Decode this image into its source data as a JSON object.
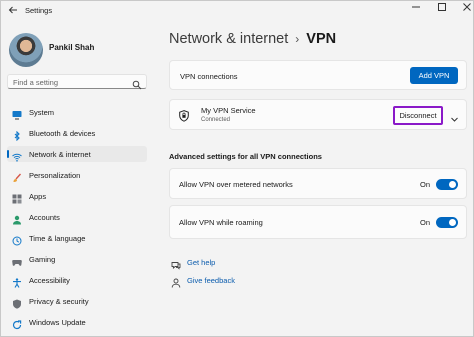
{
  "window": {
    "app_title": "Settings"
  },
  "sidebar": {
    "user_name": "Pankil Shah",
    "search_placeholder": "Find a setting",
    "items": [
      {
        "label": "System",
        "icon": "monitor-icon"
      },
      {
        "label": "Bluetooth & devices",
        "icon": "bluetooth-icon"
      },
      {
        "label": "Network & internet",
        "icon": "wifi-icon",
        "selected": true
      },
      {
        "label": "Personalization",
        "icon": "brush-icon"
      },
      {
        "label": "Apps",
        "icon": "apps-grid-icon"
      },
      {
        "label": "Accounts",
        "icon": "person-icon"
      },
      {
        "label": "Time & language",
        "icon": "clock-globe-icon"
      },
      {
        "label": "Gaming",
        "icon": "gamepad-icon"
      },
      {
        "label": "Accessibility",
        "icon": "accessibility-icon"
      },
      {
        "label": "Privacy & security",
        "icon": "shield-icon"
      },
      {
        "label": "Windows Update",
        "icon": "refresh-icon"
      }
    ]
  },
  "header": {
    "parent": "Network & internet",
    "current": "VPN"
  },
  "vpn": {
    "connections_label": "VPN connections",
    "add_button": "Add VPN",
    "service_name": "My VPN Service",
    "service_status": "Connected",
    "disconnect_button": "Disconnect"
  },
  "advanced": {
    "title": "Advanced settings for all VPN connections",
    "metered_label": "Allow VPN over metered networks",
    "metered_state": "On",
    "roaming_label": "Allow VPN while roaming",
    "roaming_state": "On"
  },
  "links": {
    "help": "Get help",
    "feedback": "Give feedback"
  },
  "colors": {
    "accent": "#0067c0",
    "highlight_border": "#8a19c8",
    "background": "#f3f3f3",
    "card": "#fbfbfb"
  }
}
